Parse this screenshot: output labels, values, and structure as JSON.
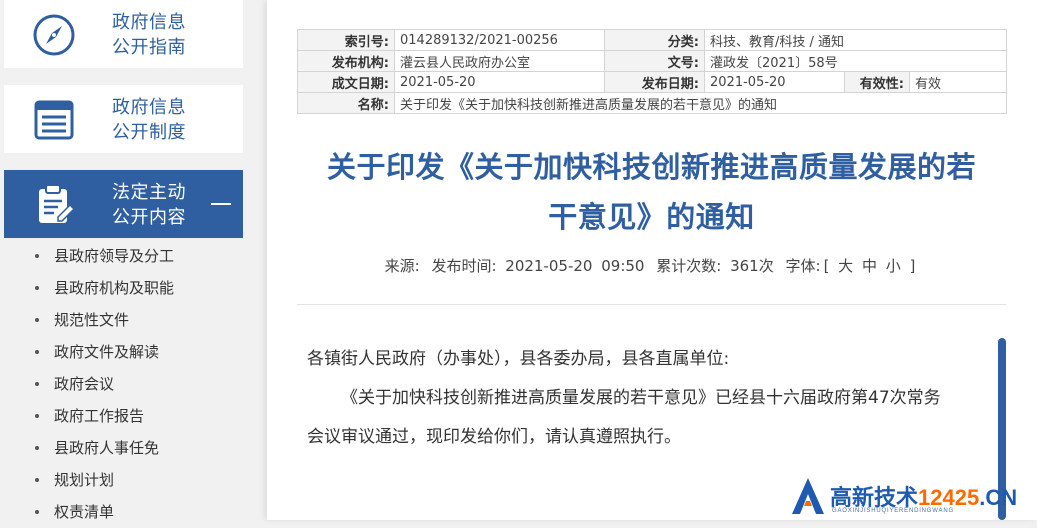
{
  "sidebar": {
    "nav": [
      {
        "label_line1": "政府信息",
        "label_line2": "公开指南",
        "icon": "compass-icon"
      },
      {
        "label_line1": "政府信息",
        "label_line2": "公开制度",
        "icon": "list-document-icon"
      },
      {
        "label_line1": "法定主动",
        "label_line2": "公开内容",
        "icon": "clipboard-edit-icon",
        "active": true
      }
    ],
    "subitems": [
      "县政府领导及分工",
      "县政府机构及职能",
      "规范性文件",
      "政府文件及解读",
      "政府会议",
      "政府工作报告",
      "县政府人事任免",
      "规划计划",
      "权责清单"
    ]
  },
  "meta": {
    "index_label": "索引号:",
    "index_value": "014289132/2021-00256",
    "category_label": "分类:",
    "category_value": "科技、教育/科技 / 通知",
    "publisher_label": "发布机构:",
    "publisher_value": "灌云县人民政府办公室",
    "docno_label": "文号:",
    "docno_value": "灌政发〔2021〕58号",
    "created_label": "成文日期:",
    "created_value": "2021-05-20",
    "published_label": "发布日期:",
    "published_value": "2021-05-20",
    "validity_label": "有效性:",
    "validity_value": "有效",
    "name_label": "名称:",
    "name_value": "关于印发《关于加快科技创新推进高质量发展的若干意见》的通知"
  },
  "article": {
    "title_line1": "关于印发《关于加快科技创新推进高质量发展的若",
    "title_line2": "干意见》的通知",
    "source": "来源:",
    "time": "发布时间:  2021-05-20 09:50",
    "views": "累计次数:   361次",
    "font_size": "字体:",
    "font_options": "[ 大 中 小 ]",
    "salutation": "各镇街人民政府（办事处），县各委办局，县各直属单位:",
    "para1_line1": "《关于加快科技创新推进高质量发展的若干意见》已经县十六届政府第47次常务",
    "para1_line2": "会议审议通过，现印发给你们，请认真遵照执行。"
  },
  "watermark": {
    "text_cn": "高新技术",
    "text_num": "12425",
    "text_suffix": ".CN",
    "subtext": "GAOXINJISHUQIYERENDINGWANG"
  },
  "colors": {
    "accent": "#2f5fa0",
    "watermark_orange": "#ff6a00"
  }
}
